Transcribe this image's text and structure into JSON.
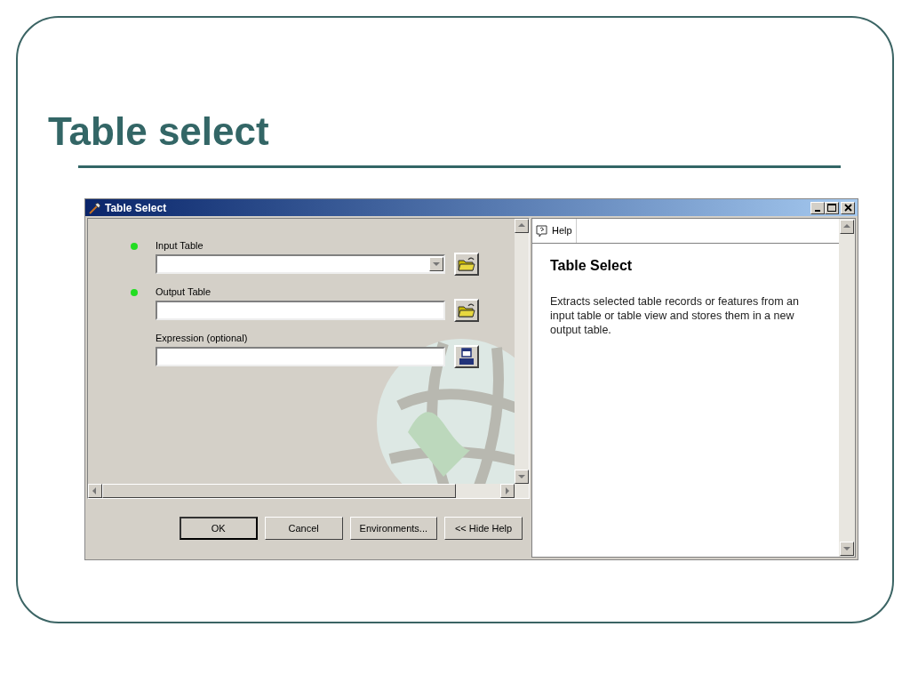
{
  "slide": {
    "title": "Table select"
  },
  "window": {
    "title": "Table Select"
  },
  "parameters": [
    {
      "label": "Input Table",
      "required": true,
      "kind": "combo"
    },
    {
      "label": "Output Table",
      "required": true,
      "kind": "field"
    },
    {
      "label": "Expression (optional)",
      "required": false,
      "kind": "query"
    }
  ],
  "buttons": [
    {
      "label": "OK",
      "default": true
    },
    {
      "label": "Cancel",
      "default": false
    },
    {
      "label": "Environments...",
      "default": false
    },
    {
      "label": "<< Hide Help",
      "default": false
    }
  ],
  "help": {
    "tab": "Help",
    "heading": "Table Select",
    "text": "Extracts selected table records or features from an input table or table view and stores them in a new output table."
  }
}
